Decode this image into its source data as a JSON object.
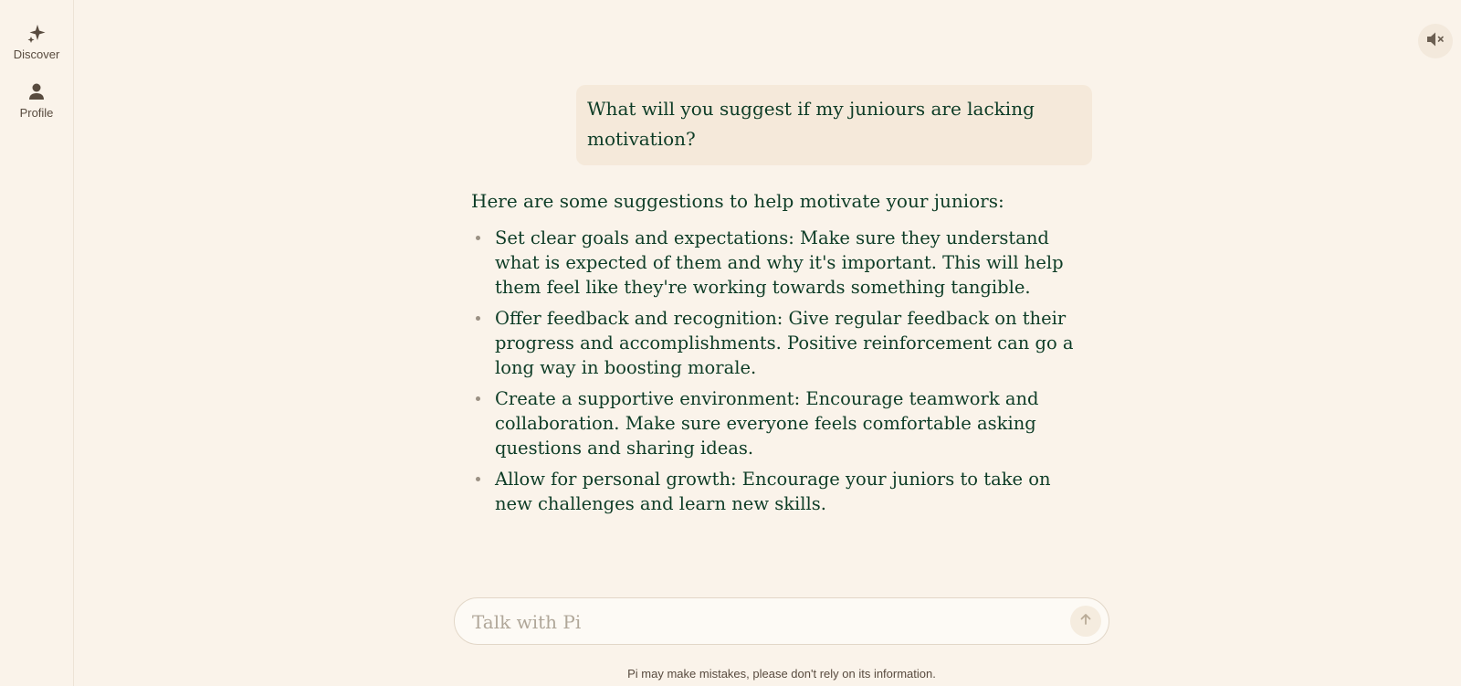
{
  "sidebar": {
    "items": [
      {
        "label": "Discover",
        "icon": "sparkle-icon"
      },
      {
        "label": "Profile",
        "icon": "person-icon"
      }
    ]
  },
  "header": {
    "mute_icon": "speaker-muted-icon"
  },
  "conversation": {
    "user_message": "What will you suggest if my juniours are lacking motivation?",
    "assistant_intro": "Here are some suggestions to help motivate your juniors:",
    "assistant_points": [
      "Set clear goals and expectations: Make sure they understand what is expected of them and why it's important. This will help them feel like they're working towards something tangible.",
      "Offer feedback and recognition: Give regular feedback on their progress and accomplishments. Positive reinforcement can go a long way in boosting morale.",
      "Create a supportive environment: Encourage teamwork and collaboration. Make sure everyone feels comfortable asking questions and sharing ideas.",
      "Allow for personal growth: Encourage your juniors to take on new challenges and learn new skills."
    ]
  },
  "composer": {
    "placeholder": "Talk with Pi",
    "value": "",
    "send_icon": "arrow-up-icon"
  },
  "footer": {
    "disclaimer": "Pi may make mistakes, please don't rely on its information."
  },
  "colors": {
    "background": "#faf3ea",
    "text": "#0d3c26",
    "user_bubble": "#f5e9da",
    "muted_text": "#584b3f"
  }
}
